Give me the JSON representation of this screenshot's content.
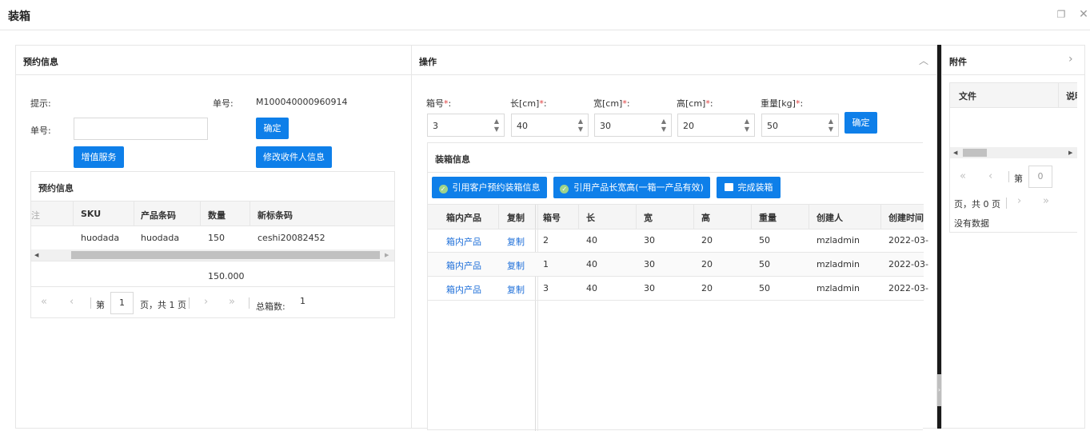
{
  "window": {
    "title": "装箱",
    "restore_icon": "restore-icon",
    "close_icon": "close-icon"
  },
  "left": {
    "panel_title": "预约信息",
    "tip_label": "提示:",
    "no_label": "单号:",
    "no_value": "M100040000960914",
    "order_label": "单号:",
    "order_value": "",
    "confirm_label": "确定",
    "vas_label": "增值服务",
    "modify_label": "修改收件人信息",
    "grid_title": "预约信息",
    "columns": [
      "注",
      "SKU",
      "产品条码",
      "数量",
      "新标条码"
    ],
    "rows": [
      {
        "sku": "huodada",
        "barcode": "huodada",
        "qty": "150",
        "newcode": "ceshi20082452"
      }
    ],
    "total_qty": "150.000",
    "page_prefix": "第",
    "page_value": "1",
    "page_suffix": "页，共 1 页",
    "total_box_label": "总箱数:",
    "total_box_value": "1"
  },
  "middle": {
    "panel_title": "操作",
    "fields": [
      {
        "label": "箱号",
        "value": "3"
      },
      {
        "label": "长[cm]",
        "value": "40"
      },
      {
        "label": "宽[cm]",
        "value": "30"
      },
      {
        "label": "高[cm]",
        "value": "20"
      },
      {
        "label": "重量[kg]",
        "value": "50"
      }
    ],
    "required_mark": "*",
    "colon": ":",
    "confirm_label": "确定",
    "box_info_title": "装箱信息",
    "btn_ref_customer": "引用客户预约装箱信息",
    "btn_ref_product": "引用产品长宽高(一箱一产品有效)",
    "btn_finish": "完成装箱",
    "columns": [
      "箱内产品",
      "复制",
      "箱号",
      "长",
      "宽",
      "高",
      "重量",
      "创建人",
      "创建时间"
    ],
    "rows": [
      {
        "product": "箱内产品",
        "copy": "复制",
        "box": "2",
        "l": "40",
        "w": "30",
        "h": "20",
        "weight": "50",
        "creator": "mzladmin",
        "time": "2022-03-"
      },
      {
        "product": "箱内产品",
        "copy": "复制",
        "box": "1",
        "l": "40",
        "w": "30",
        "h": "20",
        "weight": "50",
        "creator": "mzladmin",
        "time": "2022-03-"
      },
      {
        "product": "箱内产品",
        "copy": "复制",
        "box": "3",
        "l": "40",
        "w": "30",
        "h": "20",
        "weight": "50",
        "creator": "mzladmin",
        "time": "2022-03-"
      }
    ]
  },
  "right": {
    "panel_title": "附件",
    "columns": [
      "文件",
      "说明"
    ],
    "page_prefix": "第",
    "page_value": "0",
    "page_suffix": "页，共 0 页",
    "empty_text": "没有数据"
  }
}
